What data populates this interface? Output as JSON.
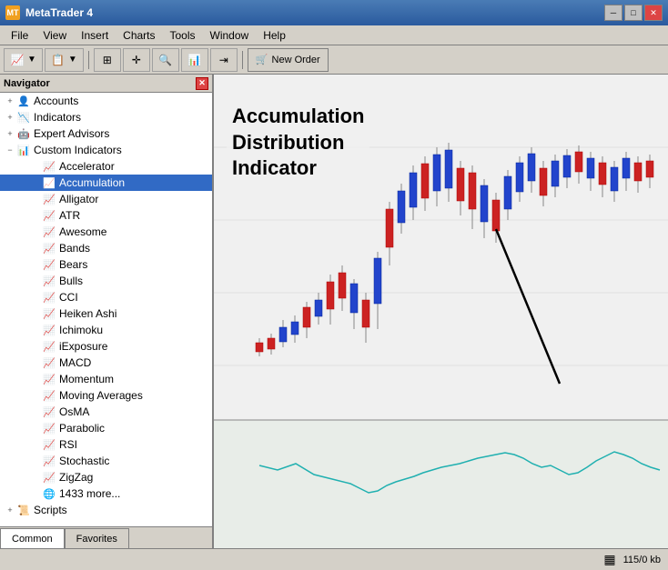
{
  "titleBar": {
    "title": "MetaTrader 4",
    "controls": {
      "minimize": "─",
      "maximize": "□",
      "close": "✕"
    }
  },
  "menuBar": {
    "items": [
      "File",
      "View",
      "Insert",
      "Charts",
      "Tools",
      "Window",
      "Help"
    ]
  },
  "toolbar": {
    "newOrderLabel": "New Order"
  },
  "navigator": {
    "title": "Navigator",
    "tree": {
      "accounts": "Accounts",
      "indicators": "Indicators",
      "expertAdvisors": "Expert Advisors",
      "customIndicators": "Custom Indicators",
      "items": [
        "Accelerator",
        "Accumulation",
        "Alligator",
        "ATR",
        "Awesome",
        "Bands",
        "Bears",
        "Bulls",
        "CCI",
        "Heiken Ashi",
        "Ichimoku",
        "iExposure",
        "MACD",
        "Momentum",
        "Moving Averages",
        "OsMA",
        "Parabolic",
        "RSI",
        "Stochastic",
        "ZigZag",
        "1433 more..."
      ],
      "scripts": "Scripts"
    },
    "tabs": {
      "common": "Common",
      "favorites": "Favorites"
    }
  },
  "chart": {
    "annotation": {
      "line1": "Accumulation",
      "line2": "Distribution",
      "line3": "Indicator"
    }
  },
  "statusBar": {
    "memory": "115/0 kb"
  }
}
